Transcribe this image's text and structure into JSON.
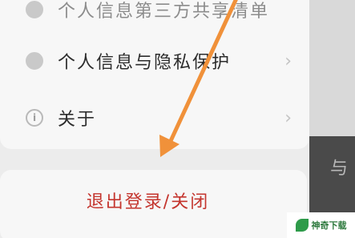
{
  "settings": {
    "items": [
      {
        "label": "个人信息第三方共享清单",
        "icon": "share-icon"
      },
      {
        "label": "个人信息与隐私保护",
        "icon": "privacy-icon"
      },
      {
        "label": "关于",
        "icon": "info-icon",
        "icon_glyph": "i"
      }
    ]
  },
  "logout": {
    "label": "退出登录/关闭"
  },
  "side_panel": {
    "peek_text": "与"
  },
  "watermark": {
    "text": "神奇下载"
  },
  "colors": {
    "logout_text": "#c4352e",
    "arrow": "#f0913a",
    "watermark_green": "#2e9b4a"
  }
}
